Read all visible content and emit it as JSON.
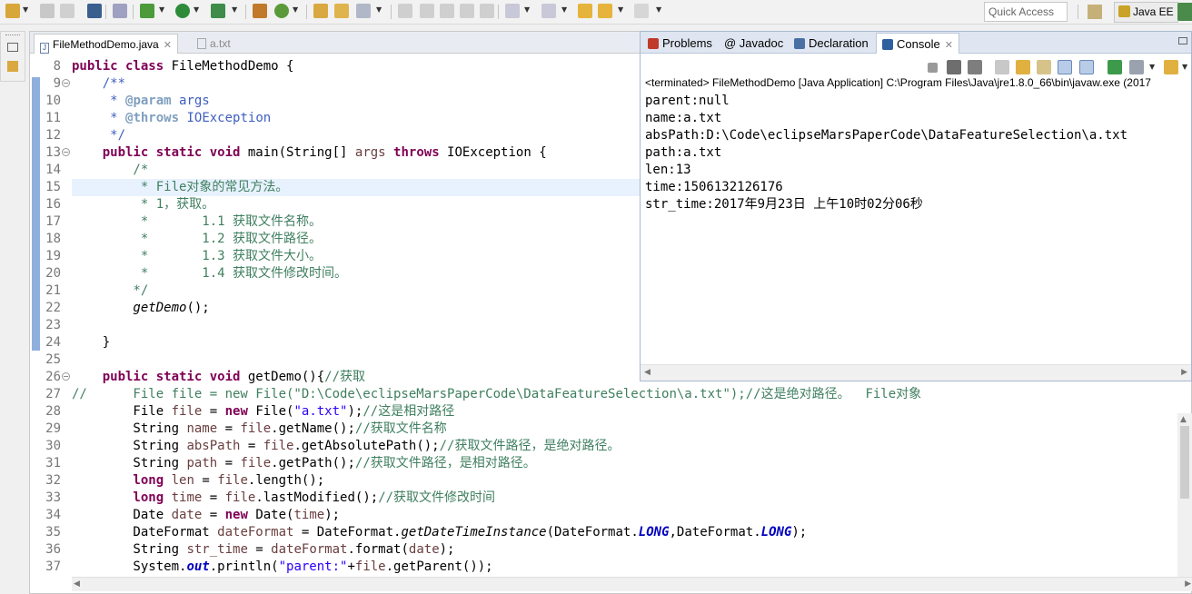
{
  "toolbar": {
    "quick_access_placeholder": "Quick Access",
    "perspective_label": "Java EE"
  },
  "editor": {
    "tabs": [
      {
        "label": "FileMethodDemo.java",
        "close": "✕"
      },
      {
        "label": "a.txt"
      }
    ],
    "lines": [
      {
        "n": "8",
        "fold": "",
        "segs": [
          [
            "kw",
            "public class "
          ],
          [
            "",
            "FileMethodDemo {"
          ]
        ]
      },
      {
        "n": "9",
        "fold": "⊖",
        "segs": [
          [
            "jd",
            "    /**"
          ]
        ]
      },
      {
        "n": "10",
        "fold": "",
        "segs": [
          [
            "jd",
            "     * "
          ],
          [
            "jt",
            "@param"
          ],
          [
            "jd",
            " args"
          ]
        ]
      },
      {
        "n": "11",
        "fold": "",
        "segs": [
          [
            "jd",
            "     * "
          ],
          [
            "jt",
            "@throws"
          ],
          [
            "jd",
            " IOException"
          ]
        ]
      },
      {
        "n": "12",
        "fold": "",
        "segs": [
          [
            "jd",
            "     */"
          ]
        ]
      },
      {
        "n": "13",
        "fold": "⊖",
        "segs": [
          [
            "kw",
            "    public static void "
          ],
          [
            "",
            "main(String[] "
          ],
          [
            "vr",
            "args"
          ],
          [
            "",
            " "
          ],
          [
            "kw",
            "throws"
          ],
          [
            "",
            " IOException {"
          ]
        ]
      },
      {
        "n": "14",
        "fold": "",
        "segs": [
          [
            "cm",
            "        /*"
          ]
        ]
      },
      {
        "n": "15",
        "fold": "",
        "segs": [
          [
            "cm",
            "         * File对象的常见方法。"
          ]
        ]
      },
      {
        "n": "16",
        "fold": "",
        "segs": [
          [
            "cm",
            "         * 1，获取。"
          ]
        ]
      },
      {
        "n": "17",
        "fold": "",
        "segs": [
          [
            "cm",
            "         *       1.1 获取文件名称。"
          ]
        ]
      },
      {
        "n": "18",
        "fold": "",
        "segs": [
          [
            "cm",
            "         *       1.2 获取文件路径。"
          ]
        ]
      },
      {
        "n": "19",
        "fold": "",
        "segs": [
          [
            "cm",
            "         *       1.3 获取文件大小。"
          ]
        ]
      },
      {
        "n": "20",
        "fold": "",
        "segs": [
          [
            "cm",
            "         *       1.4 获取文件修改时间。"
          ]
        ]
      },
      {
        "n": "21",
        "fold": "",
        "segs": [
          [
            "cm",
            "        */"
          ]
        ]
      },
      {
        "n": "22",
        "fold": "",
        "segs": [
          [
            "it",
            "        getDemo"
          ],
          [
            "",
            "();"
          ]
        ]
      },
      {
        "n": "23",
        "fold": "",
        "segs": [
          [
            "",
            ""
          ]
        ]
      },
      {
        "n": "24",
        "fold": "",
        "segs": [
          [
            "",
            "    }"
          ]
        ]
      },
      {
        "n": "25",
        "fold": "",
        "segs": [
          [
            "",
            ""
          ]
        ]
      },
      {
        "n": "26",
        "fold": "⊖",
        "segs": [
          [
            "kw",
            "    public static void "
          ],
          [
            "",
            "getDemo(){"
          ],
          [
            "cm",
            "//获取"
          ]
        ]
      },
      {
        "n": "27",
        "fold": "",
        "segs": [
          [
            "cm",
            "//      File file = new File(\"D:\\Code\\eclipseMarsPaperCode\\DataFeatureSelection\\a.txt\");//这是绝对路径。  File对象"
          ]
        ]
      },
      {
        "n": "28",
        "fold": "",
        "segs": [
          [
            "",
            "        File "
          ],
          [
            "vr",
            "file"
          ],
          [
            "",
            " = "
          ],
          [
            "kw",
            "new"
          ],
          [
            "",
            " File("
          ],
          [
            "st",
            "\"a.txt\""
          ],
          [
            "",
            ");"
          ],
          [
            "cm",
            "//这是相对路径"
          ]
        ]
      },
      {
        "n": "29",
        "fold": "",
        "segs": [
          [
            "",
            "        String "
          ],
          [
            "vr",
            "name"
          ],
          [
            "",
            " = "
          ],
          [
            "vr",
            "file"
          ],
          [
            "",
            ".getName();"
          ],
          [
            "cm",
            "//获取文件名称"
          ]
        ]
      },
      {
        "n": "30",
        "fold": "",
        "segs": [
          [
            "",
            "        String "
          ],
          [
            "vr",
            "absPath"
          ],
          [
            "",
            " = "
          ],
          [
            "vr",
            "file"
          ],
          [
            "",
            ".getAbsolutePath();"
          ],
          [
            "cm",
            "//获取文件路径，是绝对路径。"
          ]
        ]
      },
      {
        "n": "31",
        "fold": "",
        "segs": [
          [
            "",
            "        String "
          ],
          [
            "vr",
            "path"
          ],
          [
            "",
            " = "
          ],
          [
            "vr",
            "file"
          ],
          [
            "",
            ".getPath();"
          ],
          [
            "cm",
            "//获取文件路径，是相对路径。"
          ]
        ]
      },
      {
        "n": "32",
        "fold": "",
        "segs": [
          [
            "kw",
            "        long"
          ],
          [
            "",
            " "
          ],
          [
            "vr",
            "len"
          ],
          [
            "",
            " = "
          ],
          [
            "vr",
            "file"
          ],
          [
            "",
            ".length();"
          ]
        ]
      },
      {
        "n": "33",
        "fold": "",
        "segs": [
          [
            "kw",
            "        long"
          ],
          [
            "",
            " "
          ],
          [
            "vr",
            "time"
          ],
          [
            "",
            " = "
          ],
          [
            "vr",
            "file"
          ],
          [
            "",
            ".lastModified();"
          ],
          [
            "cm",
            "//获取文件修改时间"
          ]
        ]
      },
      {
        "n": "34",
        "fold": "",
        "segs": [
          [
            "",
            "        Date "
          ],
          [
            "vr",
            "date"
          ],
          [
            "",
            " = "
          ],
          [
            "kw",
            "new"
          ],
          [
            "",
            " Date("
          ],
          [
            "vr",
            "time"
          ],
          [
            "",
            ");"
          ]
        ]
      },
      {
        "n": "35",
        "fold": "",
        "segs": [
          [
            "",
            "        DateFormat "
          ],
          [
            "vr",
            "dateFormat"
          ],
          [
            "",
            " = DateFormat."
          ],
          [
            "it",
            "getDateTimeInstance"
          ],
          [
            "",
            "(DateFormat."
          ],
          [
            "cn",
            "LONG"
          ],
          [
            "",
            ",DateFormat."
          ],
          [
            "cn",
            "LONG"
          ],
          [
            "",
            ");"
          ]
        ]
      },
      {
        "n": "36",
        "fold": "",
        "segs": [
          [
            "",
            "        String "
          ],
          [
            "vr",
            "str_time"
          ],
          [
            "",
            " = "
          ],
          [
            "vr",
            "dateFormat"
          ],
          [
            "",
            ".format("
          ],
          [
            "vr",
            "date"
          ],
          [
            "",
            ");"
          ]
        ]
      },
      {
        "n": "37",
        "fold": "",
        "segs": [
          [
            "",
            "        System."
          ],
          [
            "sf",
            "out"
          ],
          [
            "",
            ".println("
          ],
          [
            "st",
            "\"parent:\""
          ],
          [
            "",
            "+"
          ],
          [
            "vr",
            "file"
          ],
          [
            "",
            ".getParent());"
          ]
        ]
      }
    ]
  },
  "console": {
    "tabs": [
      {
        "label": "Problems",
        "icon": "problems-icon",
        "color": "#c0392b"
      },
      {
        "label": "@ Javadoc",
        "icon": "javadoc-icon",
        "color": "#777777"
      },
      {
        "label": "Declaration",
        "icon": "declaration-icon",
        "color": "#4a6fa5"
      },
      {
        "label": "Console",
        "icon": "console-icon",
        "color": "#2f5f9f",
        "close": "✕"
      }
    ],
    "header": "<terminated> FileMethodDemo [Java Application] C:\\Program Files\\Java\\jre1.8.0_66\\bin\\javaw.exe (2017",
    "output": [
      "parent:null",
      "name:a.txt",
      "absPath:D:\\Code\\eclipseMarsPaperCode\\DataFeatureSelection\\a.txt",
      "path:a.txt",
      "len:13",
      "time:1506132126176",
      "str_time:2017年9月23日 上午10时02分06秒"
    ]
  }
}
